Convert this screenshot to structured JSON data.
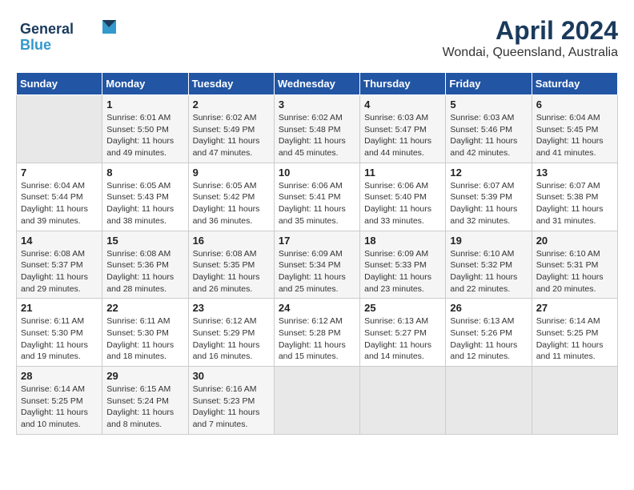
{
  "header": {
    "logo_line1": "General",
    "logo_line2": "Blue",
    "month": "April 2024",
    "location": "Wondai, Queensland, Australia"
  },
  "weekdays": [
    "Sunday",
    "Monday",
    "Tuesday",
    "Wednesday",
    "Thursday",
    "Friday",
    "Saturday"
  ],
  "weeks": [
    [
      {
        "day": "",
        "empty": true
      },
      {
        "day": "1",
        "sunrise": "Sunrise: 6:01 AM",
        "sunset": "Sunset: 5:50 PM",
        "daylight": "Daylight: 11 hours and 49 minutes."
      },
      {
        "day": "2",
        "sunrise": "Sunrise: 6:02 AM",
        "sunset": "Sunset: 5:49 PM",
        "daylight": "Daylight: 11 hours and 47 minutes."
      },
      {
        "day": "3",
        "sunrise": "Sunrise: 6:02 AM",
        "sunset": "Sunset: 5:48 PM",
        "daylight": "Daylight: 11 hours and 45 minutes."
      },
      {
        "day": "4",
        "sunrise": "Sunrise: 6:03 AM",
        "sunset": "Sunset: 5:47 PM",
        "daylight": "Daylight: 11 hours and 44 minutes."
      },
      {
        "day": "5",
        "sunrise": "Sunrise: 6:03 AM",
        "sunset": "Sunset: 5:46 PM",
        "daylight": "Daylight: 11 hours and 42 minutes."
      },
      {
        "day": "6",
        "sunrise": "Sunrise: 6:04 AM",
        "sunset": "Sunset: 5:45 PM",
        "daylight": "Daylight: 11 hours and 41 minutes."
      }
    ],
    [
      {
        "day": "7",
        "sunrise": "Sunrise: 6:04 AM",
        "sunset": "Sunset: 5:44 PM",
        "daylight": "Daylight: 11 hours and 39 minutes."
      },
      {
        "day": "8",
        "sunrise": "Sunrise: 6:05 AM",
        "sunset": "Sunset: 5:43 PM",
        "daylight": "Daylight: 11 hours and 38 minutes."
      },
      {
        "day": "9",
        "sunrise": "Sunrise: 6:05 AM",
        "sunset": "Sunset: 5:42 PM",
        "daylight": "Daylight: 11 hours and 36 minutes."
      },
      {
        "day": "10",
        "sunrise": "Sunrise: 6:06 AM",
        "sunset": "Sunset: 5:41 PM",
        "daylight": "Daylight: 11 hours and 35 minutes."
      },
      {
        "day": "11",
        "sunrise": "Sunrise: 6:06 AM",
        "sunset": "Sunset: 5:40 PM",
        "daylight": "Daylight: 11 hours and 33 minutes."
      },
      {
        "day": "12",
        "sunrise": "Sunrise: 6:07 AM",
        "sunset": "Sunset: 5:39 PM",
        "daylight": "Daylight: 11 hours and 32 minutes."
      },
      {
        "day": "13",
        "sunrise": "Sunrise: 6:07 AM",
        "sunset": "Sunset: 5:38 PM",
        "daylight": "Daylight: 11 hours and 31 minutes."
      }
    ],
    [
      {
        "day": "14",
        "sunrise": "Sunrise: 6:08 AM",
        "sunset": "Sunset: 5:37 PM",
        "daylight": "Daylight: 11 hours and 29 minutes."
      },
      {
        "day": "15",
        "sunrise": "Sunrise: 6:08 AM",
        "sunset": "Sunset: 5:36 PM",
        "daylight": "Daylight: 11 hours and 28 minutes."
      },
      {
        "day": "16",
        "sunrise": "Sunrise: 6:08 AM",
        "sunset": "Sunset: 5:35 PM",
        "daylight": "Daylight: 11 hours and 26 minutes."
      },
      {
        "day": "17",
        "sunrise": "Sunrise: 6:09 AM",
        "sunset": "Sunset: 5:34 PM",
        "daylight": "Daylight: 11 hours and 25 minutes."
      },
      {
        "day": "18",
        "sunrise": "Sunrise: 6:09 AM",
        "sunset": "Sunset: 5:33 PM",
        "daylight": "Daylight: 11 hours and 23 minutes."
      },
      {
        "day": "19",
        "sunrise": "Sunrise: 6:10 AM",
        "sunset": "Sunset: 5:32 PM",
        "daylight": "Daylight: 11 hours and 22 minutes."
      },
      {
        "day": "20",
        "sunrise": "Sunrise: 6:10 AM",
        "sunset": "Sunset: 5:31 PM",
        "daylight": "Daylight: 11 hours and 20 minutes."
      }
    ],
    [
      {
        "day": "21",
        "sunrise": "Sunrise: 6:11 AM",
        "sunset": "Sunset: 5:30 PM",
        "daylight": "Daylight: 11 hours and 19 minutes."
      },
      {
        "day": "22",
        "sunrise": "Sunrise: 6:11 AM",
        "sunset": "Sunset: 5:30 PM",
        "daylight": "Daylight: 11 hours and 18 minutes."
      },
      {
        "day": "23",
        "sunrise": "Sunrise: 6:12 AM",
        "sunset": "Sunset: 5:29 PM",
        "daylight": "Daylight: 11 hours and 16 minutes."
      },
      {
        "day": "24",
        "sunrise": "Sunrise: 6:12 AM",
        "sunset": "Sunset: 5:28 PM",
        "daylight": "Daylight: 11 hours and 15 minutes."
      },
      {
        "day": "25",
        "sunrise": "Sunrise: 6:13 AM",
        "sunset": "Sunset: 5:27 PM",
        "daylight": "Daylight: 11 hours and 14 minutes."
      },
      {
        "day": "26",
        "sunrise": "Sunrise: 6:13 AM",
        "sunset": "Sunset: 5:26 PM",
        "daylight": "Daylight: 11 hours and 12 minutes."
      },
      {
        "day": "27",
        "sunrise": "Sunrise: 6:14 AM",
        "sunset": "Sunset: 5:25 PM",
        "daylight": "Daylight: 11 hours and 11 minutes."
      }
    ],
    [
      {
        "day": "28",
        "sunrise": "Sunrise: 6:14 AM",
        "sunset": "Sunset: 5:25 PM",
        "daylight": "Daylight: 11 hours and 10 minutes."
      },
      {
        "day": "29",
        "sunrise": "Sunrise: 6:15 AM",
        "sunset": "Sunset: 5:24 PM",
        "daylight": "Daylight: 11 hours and 8 minutes."
      },
      {
        "day": "30",
        "sunrise": "Sunrise: 6:16 AM",
        "sunset": "Sunset: 5:23 PM",
        "daylight": "Daylight: 11 hours and 7 minutes."
      },
      {
        "day": "",
        "empty": true
      },
      {
        "day": "",
        "empty": true
      },
      {
        "day": "",
        "empty": true
      },
      {
        "day": "",
        "empty": true
      }
    ]
  ]
}
